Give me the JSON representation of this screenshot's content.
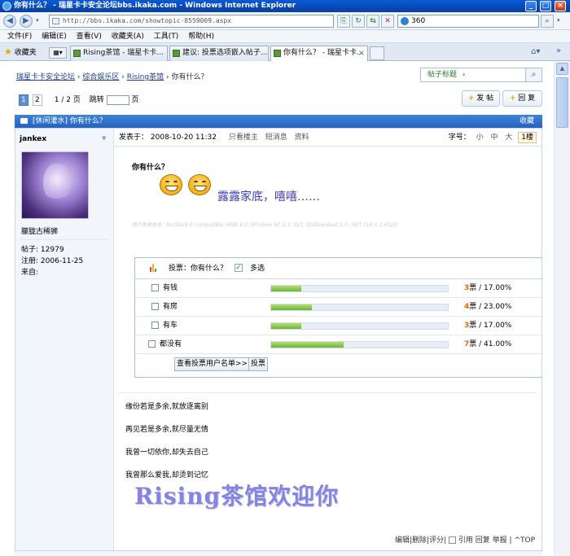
{
  "window": {
    "title": "你有什么？ - 瑞星卡卡安全论坛bbs.ikaka.com - Windows Internet Explorer"
  },
  "address": {
    "url": "http://bbs.ikaka.com/showtopic-8559009.aspx",
    "search_value": "360"
  },
  "menu": [
    "文件(F)",
    "编辑(E)",
    "查看(V)",
    "收藏夹(A)",
    "工具(T)",
    "帮助(H)"
  ],
  "favorites_label": "收藏夹",
  "tabs": [
    {
      "label": "Rising茶馆 - 瑞星卡卡..."
    },
    {
      "label": "建议: 投票选项嵌入帖子..."
    },
    {
      "label": "你有什么？ - 瑞星卡卡..."
    }
  ],
  "breadcrumb": {
    "items": [
      "瑞星卡卡安全论坛",
      "综合娱乐区",
      "Rising茶馆"
    ],
    "current": "你有什么？"
  },
  "post_search": {
    "placeholder": "帖子标题"
  },
  "pager": {
    "pages": [
      "1",
      "2"
    ],
    "current": "1",
    "summary": "1 / 2 页",
    "jump_label": "跳转",
    "jump_suffix": "页"
  },
  "actions": {
    "new_post": "发 帖",
    "reply": "回 复"
  },
  "thread": {
    "title": "[休闲灌水] 你有什么？",
    "collect": "收藏"
  },
  "user": {
    "name": "jankex",
    "title": "朦胧古稀狮",
    "posts_label": "帖子:",
    "posts": "12979",
    "reg_label": "注册:",
    "reg": "2006-11-25",
    "from_label": "来自:",
    "from": ""
  },
  "post_header": {
    "posted_label": "发表于：",
    "posted": "2008-10-20 11:32",
    "links": [
      "只看楼主",
      "短消息",
      "资料"
    ],
    "font_label": "字号：",
    "font_sizes": [
      "小",
      "中",
      "大"
    ],
    "floor": "1楼"
  },
  "post": {
    "title": "你有什么？",
    "big_text": "露露家底，嘻嘻……",
    "system_info": "用户系统信息：Mozilla/4.0 (compatible; MSIE 6.0; Windows NT 5.1; SV1; QQDownload 1.7; .NET CLR 1.1.4322)"
  },
  "poll": {
    "title": "投票：你有什么？",
    "multi": "多选",
    "options": [
      {
        "label": "有钱",
        "votes": "3",
        "unit": "票 / ",
        "pct": "17.00%",
        "fraction": 0.17
      },
      {
        "label": "有房",
        "votes": "4",
        "unit": "票 / ",
        "pct": "23.00%",
        "fraction": 0.23
      },
      {
        "label": "有车",
        "votes": "3",
        "unit": "票 / ",
        "pct": "17.00%",
        "fraction": 0.17
      },
      {
        "label": "都没有",
        "votes": "7",
        "unit": "票 / ",
        "pct": "41.00%",
        "fraction": 0.41
      }
    ],
    "view_voters": "查看投票用户名单>>",
    "vote": "投票"
  },
  "signature": [
    "缘份若是多余,就放逐离别",
    "再见若是多余,就尽量无情",
    "我曾一切依你,却失去自己",
    "我曾那么爱我,却烫到记忆"
  ],
  "rising_banner": "Rising茶馆欢迎你",
  "post_footer": {
    "links": [
      "编辑",
      "删除",
      "评分"
    ],
    "more": [
      "引用",
      "回复",
      "举报"
    ],
    "top": "TOP"
  }
}
